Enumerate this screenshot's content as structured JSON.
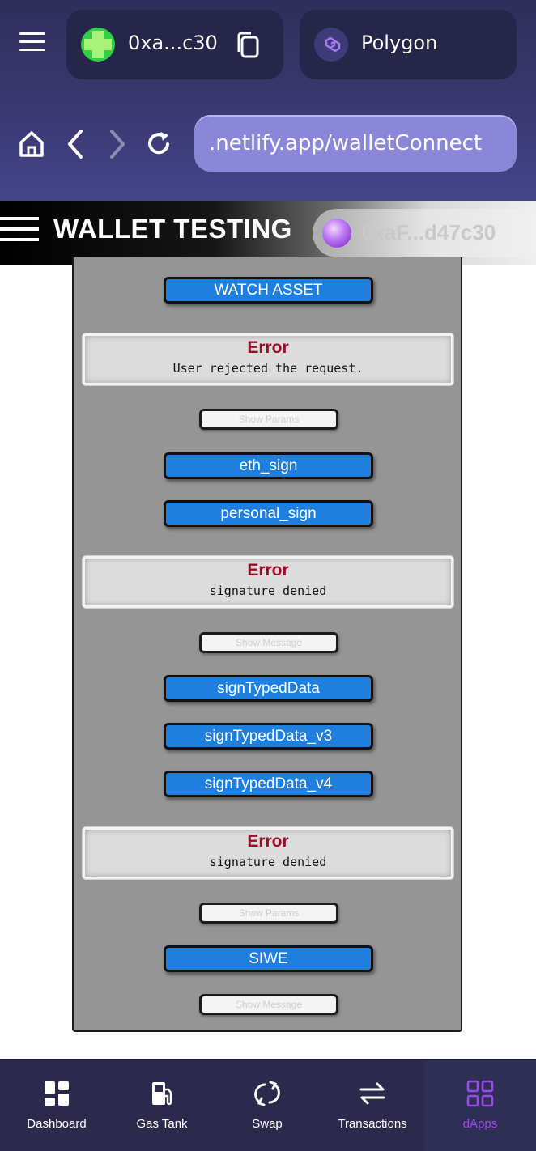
{
  "header": {
    "account_short": "0xa...c30",
    "network_name": "Polygon",
    "url": ".netlify.app/walletConnect"
  },
  "app_bar": {
    "title": "WALLET TESTING",
    "account": "0xaF...d47c30"
  },
  "panel": {
    "watch_asset_label": "WATCH ASSET",
    "error1": {
      "title": "Error",
      "message": "User rejected the request."
    },
    "show_params_1": "Show Params",
    "eth_sign_label": "eth_sign",
    "personal_sign_label": "personal_sign",
    "error2": {
      "title": "Error",
      "message": "signature denied"
    },
    "show_message_1": "Show Message",
    "sign_typed_data_label": "signTypedData",
    "sign_typed_data_v3_label": "signTypedData_v3",
    "sign_typed_data_v4_label": "signTypedData_v4",
    "error3": {
      "title": "Error",
      "message": "signature denied"
    },
    "show_params_2": "Show Params",
    "siwe_label": "SIWE",
    "show_message_2": "Show Message"
  },
  "bottom_nav": {
    "items": [
      {
        "label": "Dashboard",
        "icon": "dashboard-icon"
      },
      {
        "label": "Gas Tank",
        "icon": "gas-pump-icon"
      },
      {
        "label": "Swap",
        "icon": "swap-icon"
      },
      {
        "label": "Transactions",
        "icon": "transfer-arrows-icon"
      },
      {
        "label": "dApps",
        "icon": "apps-grid-icon"
      }
    ],
    "active": "dApps"
  },
  "colors": {
    "header_bg": "#3a3970",
    "accent_purple": "#9b49e8",
    "button_blue": "#1f7fde",
    "error_red": "#9e0c2a",
    "panel_gray": "#959595"
  }
}
